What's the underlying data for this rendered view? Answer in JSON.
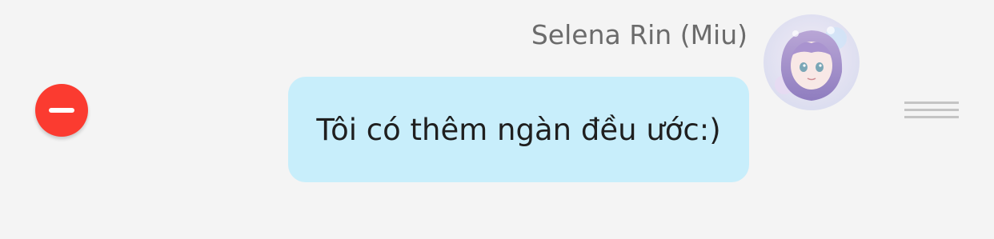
{
  "message": {
    "sender_name": "Selena Rin (Miu)",
    "text": "Tôi có thêm ngàn đều ước:)",
    "bubble_color": "#c8eefb"
  },
  "controls": {
    "delete_icon": "minus-circle-icon",
    "delete_color": "#fb3b30",
    "reorder_icon": "drag-handle-icon"
  },
  "avatar": {
    "icon": "anime-avatar-image"
  }
}
